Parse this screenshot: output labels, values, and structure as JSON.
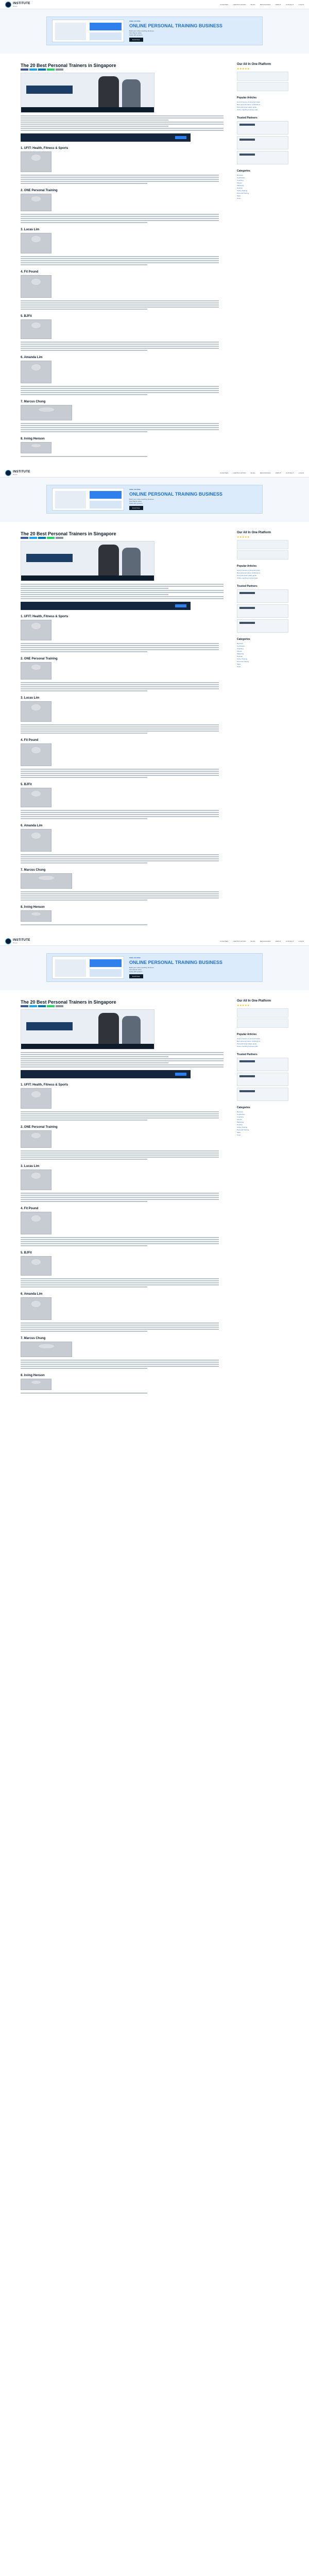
{
  "header": {
    "logo_text": "INSTITUTE",
    "logo_sub": "fitness",
    "nav": [
      "Courses",
      "Certification",
      "Blog",
      "Resources",
      "About",
      "Contact",
      "Login"
    ]
  },
  "banner": {
    "kicker": "FREE COURSE",
    "title": "ONLINE PERSONAL TRAINING BUSINESS",
    "list": [
      "Build your online coaching business",
      "Find clients online",
      "Scale with systems"
    ],
    "button": "Enroll Now"
  },
  "article": {
    "title": "The 20 Best Personal Trainers in Singapore",
    "trainers": [
      "1. UFIT: Health, Fitness & Sports",
      "2. ONE Personal Training",
      "3. Lucas Lim",
      "4. Fit Pound",
      "5. BJFit",
      "6. Amanda Lim",
      "7. Marcus Chung",
      "8. Irving Henson"
    ]
  },
  "sidebar": {
    "platform_title": "Our All In One Platform",
    "stars": "★★★★★",
    "popular": "Popular Articles",
    "popular_links": [
      "How to become a personal trainer",
      "Best personal trainer certifications",
      "Personal trainer salary guide",
      "Online coaching business plan"
    ],
    "partners": "Trusted Partners",
    "categories": "Categories",
    "category_links": [
      "Business",
      "Certification",
      "Coaching",
      "Fitness",
      "Marketing",
      "Nutrition",
      "Online Training",
      "Personal Training",
      "Sales",
      "Tools"
    ]
  },
  "colors": {
    "brand": "#0d1b2a",
    "accent": "#1d6fd1",
    "banner_bg": "#dcebfb"
  }
}
